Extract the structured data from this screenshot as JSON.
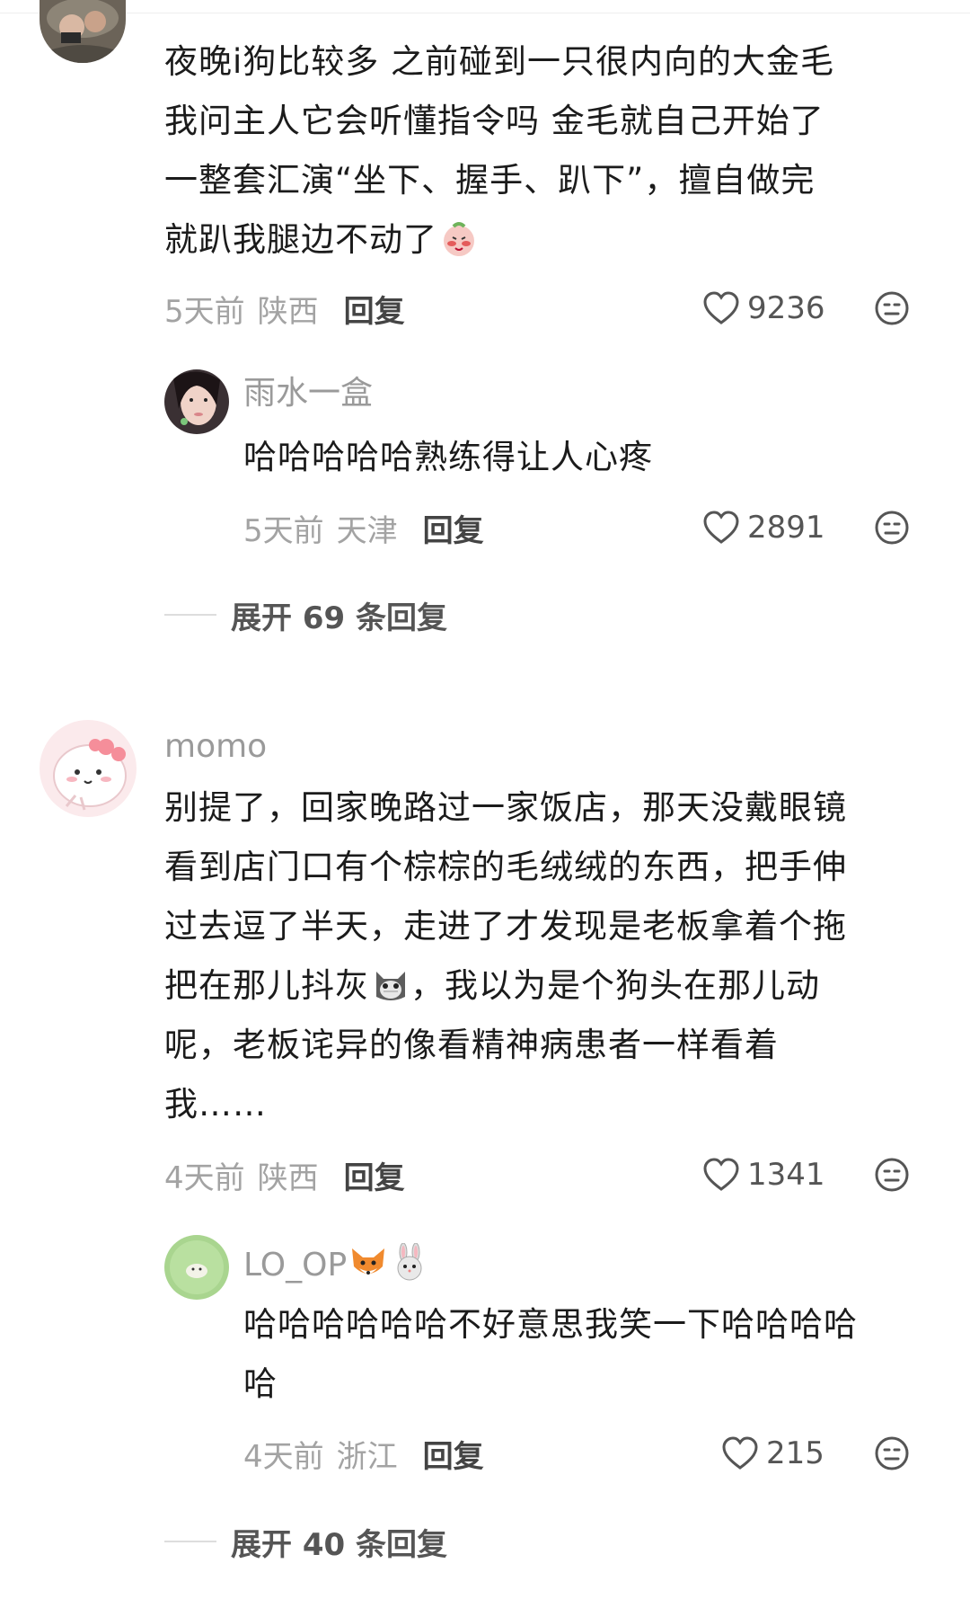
{
  "comments": [
    {
      "username": "",
      "text_lines": [
        "夜晚i狗比较多 之前碰到一只很内向的大金毛",
        "我问主人它会听懂指令吗 金毛就自己开始了",
        "一整套汇演“坐下、握手、趴下”，擅自做完",
        "就趴我腿边不动了"
      ],
      "date": "5天前",
      "region": "陕西",
      "reply_label": "回复",
      "likes": "9236",
      "replies": [
        {
          "username": "雨水一盒",
          "text_lines": [
            "哈哈哈哈哈熟练得让人心疼"
          ],
          "date": "5天前",
          "region": "天津",
          "reply_label": "回复",
          "likes": "2891"
        }
      ],
      "expand_label": "展开 69 条回复"
    },
    {
      "username": "momo",
      "text_lines": [
        "别提了，回家晚路过一家饭店，那天没戴眼镜",
        "看到店门口有个棕棕的毛绒绒的东西，把手伸",
        "过去逗了半天，走进了才发现是老板拿着个拖",
        "把在那儿抖灰",
        "，我以为是个狗头在那儿动",
        "呢，老板诧异的像看精神病患者一样看着",
        "我……"
      ],
      "date": "4天前",
      "region": "陕西",
      "reply_label": "回复",
      "likes": "1341",
      "replies": [
        {
          "username": "LO_OP",
          "text_lines": [
            "哈哈哈哈哈哈不好意思我笑一下哈哈哈哈",
            "哈"
          ],
          "date": "4天前",
          "region": "浙江",
          "reply_label": "回复",
          "likes": "215"
        }
      ],
      "expand_label": "展开 40 条回复"
    }
  ],
  "icons": {
    "like": "heart-outline-icon",
    "dislike": "neutral-face-icon",
    "emoji_1": "shy-peach-emoji",
    "emoji_2": "cat-emoji",
    "emoji_3": "fox-emoji",
    "emoji_4": "rabbit-emoji"
  },
  "colors": {
    "text": "#1b1b1b",
    "muted": "#9a9a9a",
    "reply": "#444444"
  }
}
